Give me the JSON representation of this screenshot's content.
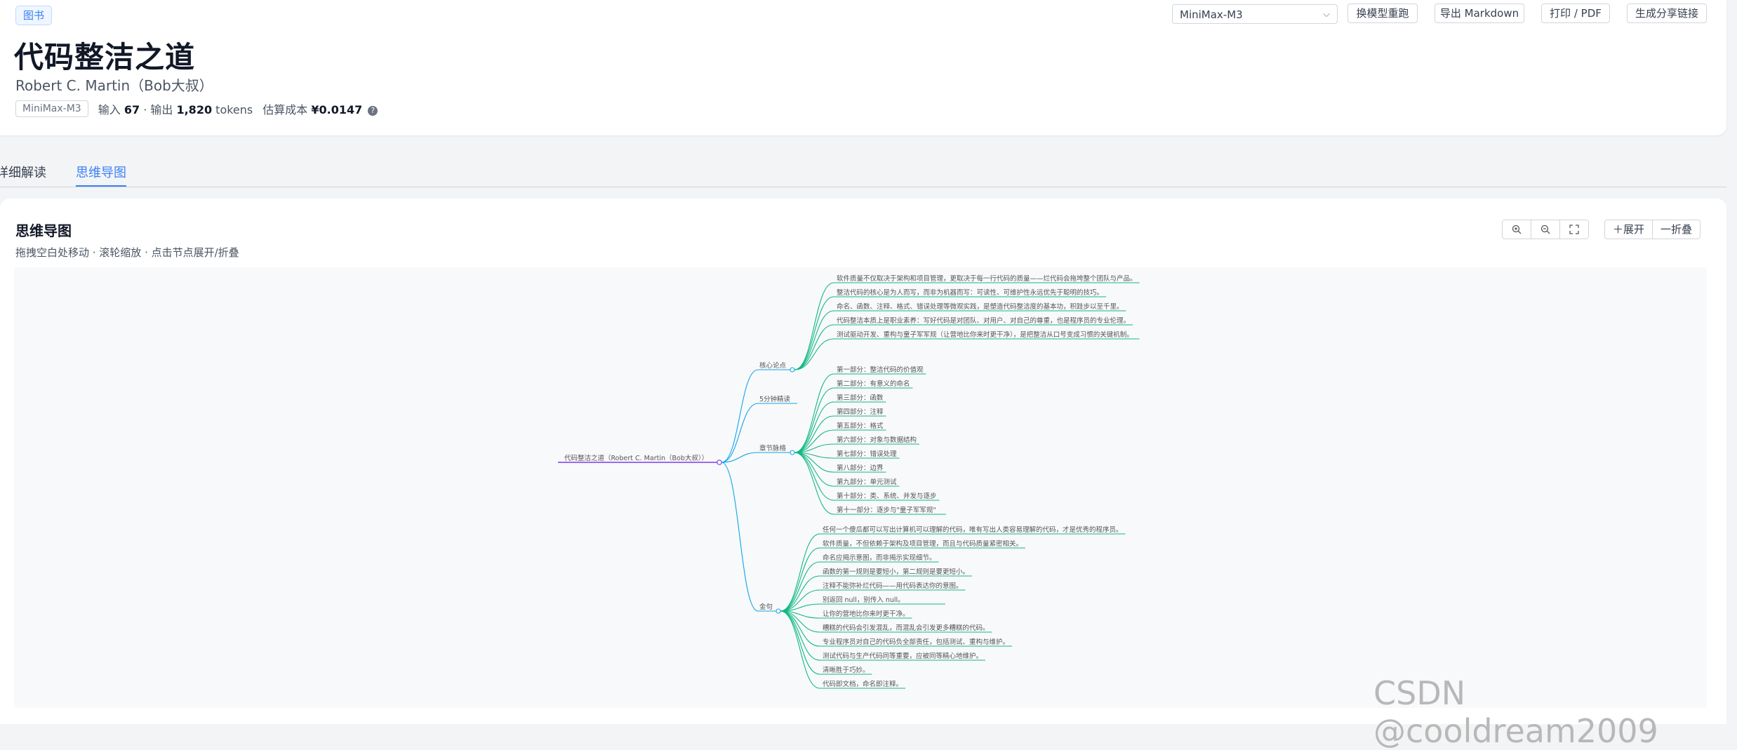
{
  "header": {
    "tag": "图书",
    "title": "代码整洁之道",
    "author": "Robert C. Martin（Bob大叔）",
    "model_chip": "MiniMax-M3",
    "input_label": "输入",
    "input_tokens": "67",
    "output_label": "· 输出",
    "output_tokens": "1,820",
    "tokens_unit": "tokens",
    "cost_label": "估算成本",
    "cost_value": "¥0.0147",
    "help_glyph": "?"
  },
  "toolbar": {
    "model_select": "MiniMax-M3",
    "rerun": "换模型重跑",
    "export_md": "导出 Markdown",
    "print": "打印 / PDF",
    "share": "生成分享链接"
  },
  "tabs": [
    {
      "label": "详细解读",
      "active": false
    },
    {
      "label": "思维导图",
      "active": true
    }
  ],
  "mindmap": {
    "title": "思维导图",
    "hint": "拖拽空白处移动 · 滚轮缩放 · 点击节点展开/折叠",
    "zoom_in_icon": "zoom-in-icon",
    "zoom_out_icon": "zoom-out-icon",
    "fullscreen_icon": "fullscreen-icon",
    "expand": "＋展开",
    "collapse": "一折叠",
    "root": "代码整洁之道（Robert C. Martin（Bob大叔））",
    "branches": [
      {
        "label": "核心论点",
        "children": [
          "软件质量不仅取决于架构和项目管理，更取决于每一行代码的质量——烂代码会拖垮整个团队与产品。",
          "整洁代码的核心是为人而写，而非为机器而写：可读性、可维护性永远优先于聪明的技巧。",
          "命名、函数、注释、格式、错误处理等微观实践，是塑造代码整洁度的基本功，积跬步以至千里。",
          "代码整洁本质上是职业素养：写好代码是对团队、对用户、对自己的尊重，也是程序员的专业伦理。",
          "测试驱动开发、重构与童子军军规（让营地比你来时更干净），是把整洁从口号变成习惯的关键机制。"
        ]
      },
      {
        "label": "5分钟精读",
        "children": []
      },
      {
        "label": "章节脉络",
        "children": [
          "第一部分：整洁代码的价值观",
          "第二部分：有意义的命名",
          "第三部分：函数",
          "第四部分：注释",
          "第五部分：格式",
          "第六部分：对象与数据结构",
          "第七部分：错误处理",
          "第八部分：边界",
          "第九部分：单元测试",
          "第十部分：类、系统、并发与逐步",
          "第十一部分：逐步与\"童子军军规\""
        ]
      },
      {
        "label": "金句",
        "children": [
          "任何一个傻瓜都可以写出计算机可以理解的代码，唯有写出人类容易理解的代码，才是优秀的程序员。",
          "软件质量，不但依赖于架构及项目管理，而且与代码质量紧密相关。",
          "命名应揭示意图，而非揭示实现细节。",
          "函数的第一规则是要短小，第二规则是要更短小。",
          "注释不能弥补烂代码——用代码表达你的意图。",
          "别返回 null，别传入 null。",
          "让你的营地比你来时更干净。",
          "糟糕的代码会引发混乱，而混乱会引发更多糟糕的代码。",
          "专业程序员对自己的代码负全部责任，包括测试、重构与维护。",
          "测试代码与生产代码同等重要，应被同等精心地维护。",
          "清晰胜于巧妙。",
          "代码即文档，命名即注释。"
        ]
      }
    ]
  },
  "colors": {
    "accent": "#3b82f6",
    "root_line": "#7c3aed",
    "branch_line": "#0ea5e9",
    "leaf_line": "#10b981"
  },
  "watermark": "CSDN @cooldream2009"
}
